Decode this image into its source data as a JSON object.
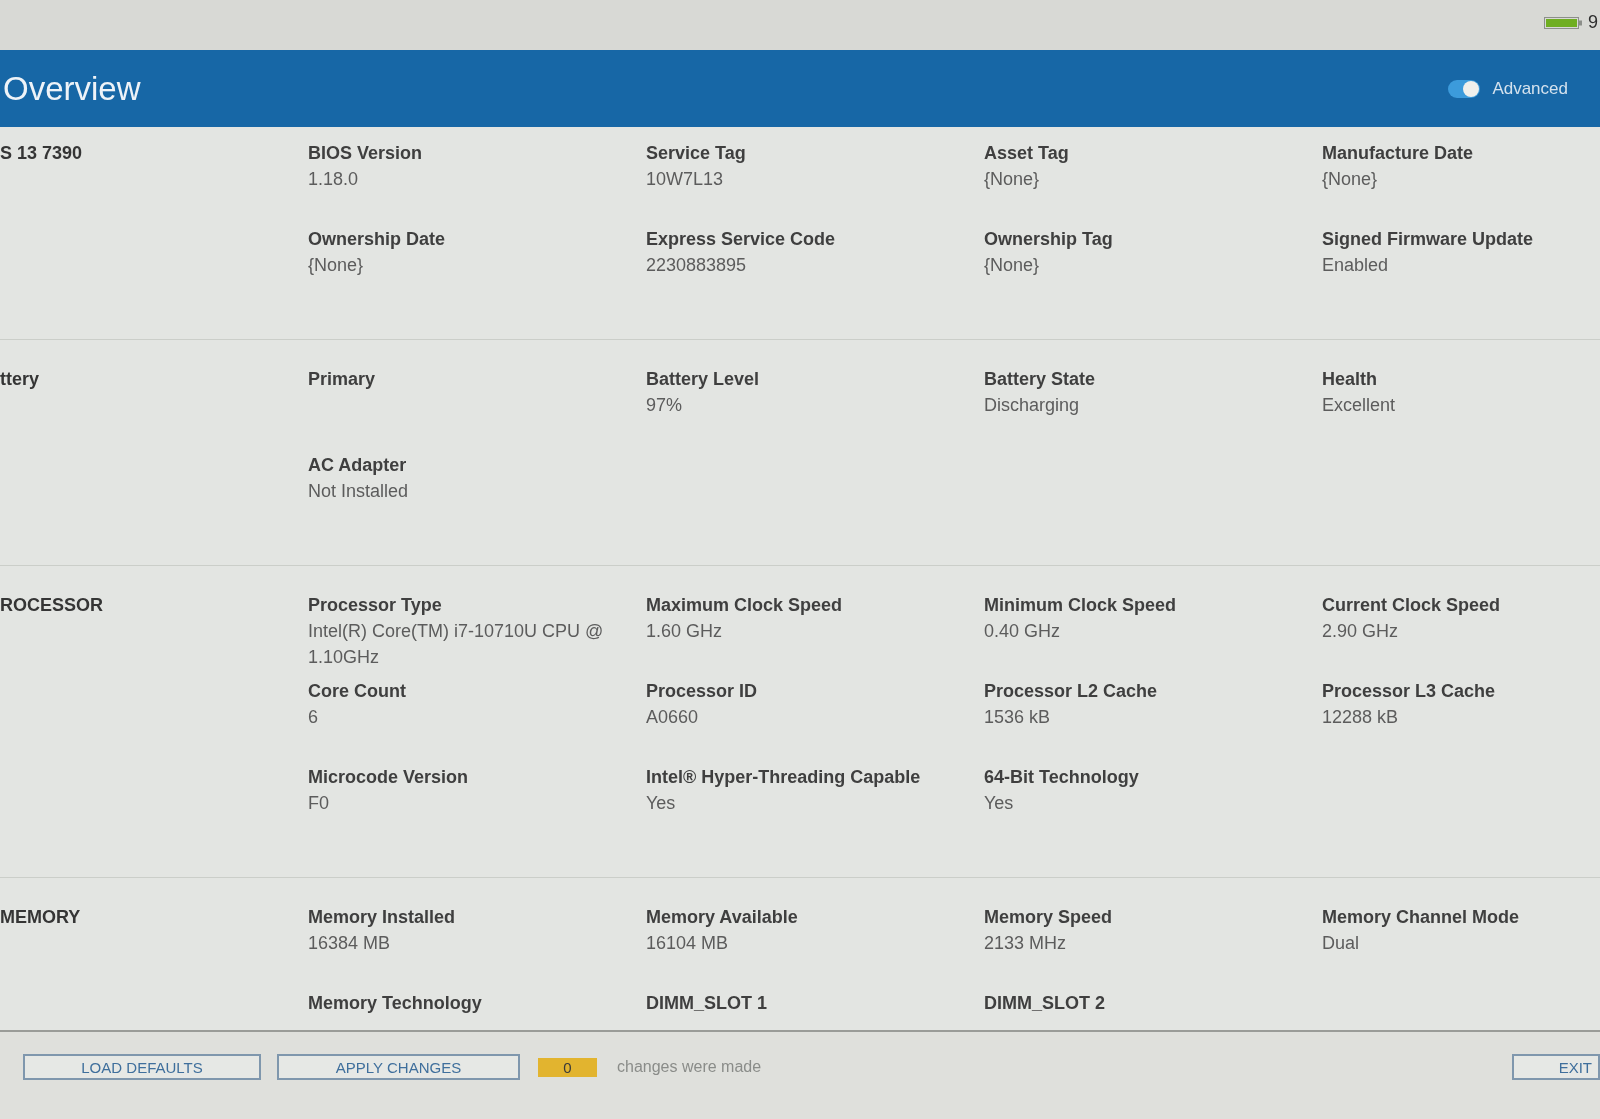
{
  "status_bar": {
    "battery_text": "9"
  },
  "header": {
    "title": "Overview",
    "advanced_toggle": {
      "label": "Advanced",
      "on": true
    }
  },
  "sections": [
    {
      "label": "S 13 7390",
      "fields": [
        {
          "label": "BIOS Version",
          "value": "1.18.0"
        },
        {
          "label": "Service Tag",
          "value": "10W7L13"
        },
        {
          "label": "Asset Tag",
          "value": "{None}"
        },
        {
          "label": "Manufacture Date",
          "value": "{None}"
        },
        {
          "label": "Ownership Date",
          "value": "{None}"
        },
        {
          "label": "Express Service Code",
          "value": "2230883895"
        },
        {
          "label": "Ownership Tag",
          "value": "{None}"
        },
        {
          "label": "Signed Firmware Update",
          "value": "Enabled"
        }
      ]
    },
    {
      "label": "ttery",
      "fields": [
        {
          "label": "Primary"
        },
        {
          "label": "Battery Level",
          "value": "97%"
        },
        {
          "label": "Battery State",
          "value": "Discharging"
        },
        {
          "label": "Health",
          "value": "Excellent"
        },
        {
          "label": "AC Adapter",
          "value": "Not Installed"
        }
      ]
    },
    {
      "label": "ROCESSOR",
      "fields": [
        {
          "label": "Processor Type",
          "value": "Intel(R) Core(TM) i7-10710U CPU @ 1.10GHz"
        },
        {
          "label": "Maximum Clock Speed",
          "value": "1.60 GHz"
        },
        {
          "label": "Minimum Clock Speed",
          "value": "0.40 GHz"
        },
        {
          "label": "Current Clock Speed",
          "value": "2.90 GHz"
        },
        {
          "label": "Core Count",
          "value": "6"
        },
        {
          "label": "Processor ID",
          "value": "A0660"
        },
        {
          "label": "Processor L2 Cache",
          "value": "1536 kB"
        },
        {
          "label": "Processor L3 Cache",
          "value": "12288 kB"
        },
        {
          "label": "Microcode Version",
          "value": "F0"
        },
        {
          "label": "Intel® Hyper-Threading Capable",
          "value": "Yes"
        },
        {
          "label": "64-Bit Technology",
          "value": "Yes"
        }
      ]
    },
    {
      "label": "MEMORY",
      "fields": [
        {
          "label": "Memory Installed",
          "value": "16384 MB"
        },
        {
          "label": "Memory Available",
          "value": "16104 MB"
        },
        {
          "label": "Memory Speed",
          "value": "2133 MHz"
        },
        {
          "label": "Memory Channel Mode",
          "value": "Dual"
        },
        {
          "label": "Memory Technology"
        },
        {
          "label": "DIMM_SLOT 1"
        },
        {
          "label": "DIMM_SLOT 2"
        }
      ]
    }
  ],
  "footer": {
    "buttons": [
      "LOAD DEFAULTS",
      "APPLY CHANGES"
    ],
    "changes": {
      "count": "0",
      "text": "changes were made"
    },
    "exit_button": "EXIT"
  }
}
